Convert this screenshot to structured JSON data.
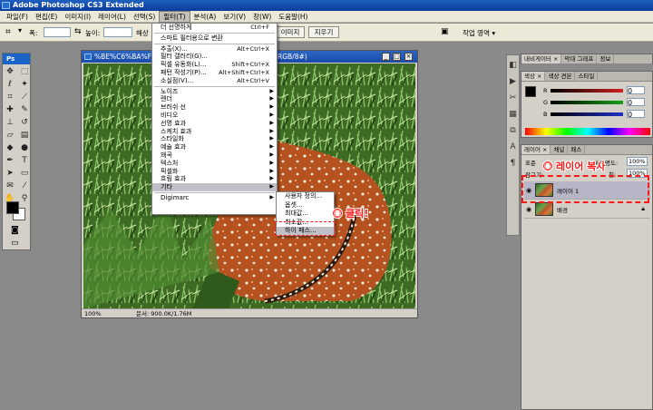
{
  "app": {
    "title": "Adobe Photoshop CS3 Extended"
  },
  "menubar": {
    "items": [
      "파일(F)",
      "편집(E)",
      "이미지(I)",
      "레이어(L)",
      "선택(S)",
      "필터(T)",
      "분석(A)",
      "보기(V)",
      "창(W)",
      "도움말(H)"
    ]
  },
  "options_bar": {
    "width_label": "폭:",
    "height_label": "높이:",
    "resolution_label": "해상",
    "front_image_button": "이미지",
    "clear_button": "지우기",
    "workspace_label": "작업 영역 ▾"
  },
  "filter_menu": {
    "items": [
      {
        "label": "더 선명하게",
        "shortcut": "Ctrl+F",
        "arrow": false
      },
      {
        "sep": true
      },
      {
        "label": "스마트 필터용으로 변환",
        "shortcut": "",
        "arrow": false
      },
      {
        "sep": true
      },
      {
        "label": "추출(X)...",
        "shortcut": "Alt+Ctrl+X",
        "arrow": false
      },
      {
        "label": "필터 갤러리(G)...",
        "shortcut": "",
        "arrow": false
      },
      {
        "label": "픽셀 유동화(L)...",
        "shortcut": "Shift+Ctrl+X",
        "arrow": false
      },
      {
        "label": "패턴 작성기(P)...",
        "shortcut": "Alt+Shift+Ctrl+X",
        "arrow": false
      },
      {
        "label": "소실점(V)...",
        "shortcut": "Alt+Ctrl+V",
        "arrow": false
      },
      {
        "sep": true
      },
      {
        "label": "노이즈",
        "shortcut": "",
        "arrow": true
      },
      {
        "label": "렌더",
        "shortcut": "",
        "arrow": true
      },
      {
        "label": "브러쉬 선",
        "shortcut": "",
        "arrow": true
      },
      {
        "label": "비디오",
        "shortcut": "",
        "arrow": true
      },
      {
        "label": "선명 효과",
        "shortcut": "",
        "arrow": true
      },
      {
        "label": "스케치 효과",
        "shortcut": "",
        "arrow": true
      },
      {
        "label": "스타일화",
        "shortcut": "",
        "arrow": true
      },
      {
        "label": "예술 효과",
        "shortcut": "",
        "arrow": true
      },
      {
        "label": "왜곡",
        "shortcut": "",
        "arrow": true
      },
      {
        "label": "텍스처",
        "shortcut": "",
        "arrow": true
      },
      {
        "label": "픽셀화",
        "shortcut": "",
        "arrow": true
      },
      {
        "label": "흐림 효과",
        "shortcut": "",
        "arrow": true
      },
      {
        "label": "기타",
        "shortcut": "",
        "arrow": true,
        "highlight": true
      },
      {
        "sep": true
      },
      {
        "label": "Digimarc",
        "shortcut": "",
        "arrow": true
      }
    ]
  },
  "submenu": {
    "items": [
      "사용자 정의...",
      "옵셋...",
      "최대값...",
      "최소값...",
      "하이 패스..."
    ],
    "highlight_index": 4
  },
  "document": {
    "title": "%BE%C6%BA%F",
    "title_tail": "RGB/8#)",
    "zoom": "100%",
    "status": "문서: 900.0K/1.76M"
  },
  "annotations": {
    "click_num": "②",
    "click_text": "클릭!",
    "dup_num": "①",
    "dup_text": "레이어 복사"
  },
  "panels": {
    "nav_tabs": [
      "내비게이터 ×",
      "막대 그래프",
      "정보"
    ],
    "color_tabs": [
      "색상 ×",
      "색상 견본",
      "스타일"
    ],
    "channels": [
      "R",
      "G",
      "B"
    ],
    "channel_values": [
      "0",
      "0",
      "0"
    ],
    "channel_colors": [
      "#d02020",
      "#18a018",
      "#2030c8"
    ],
    "layer_tabs": [
      "레이어 ×",
      "채널",
      "패스"
    ],
    "blend_label": "표준",
    "opacity_label": "불투명도:",
    "opacity_value": "100%",
    "fill_label": "칠:",
    "fill_value": "100%",
    "lock_label": "잠그기:",
    "layers": [
      {
        "name": "레이어 1",
        "selected": true,
        "locked": false
      },
      {
        "name": "배경",
        "selected": false,
        "locked": true
      }
    ]
  },
  "colors": {
    "accent_red": "#ff1a1a",
    "titlebar_blue": "#1f5fbf",
    "workspace_gray": "#8a8a8a"
  }
}
